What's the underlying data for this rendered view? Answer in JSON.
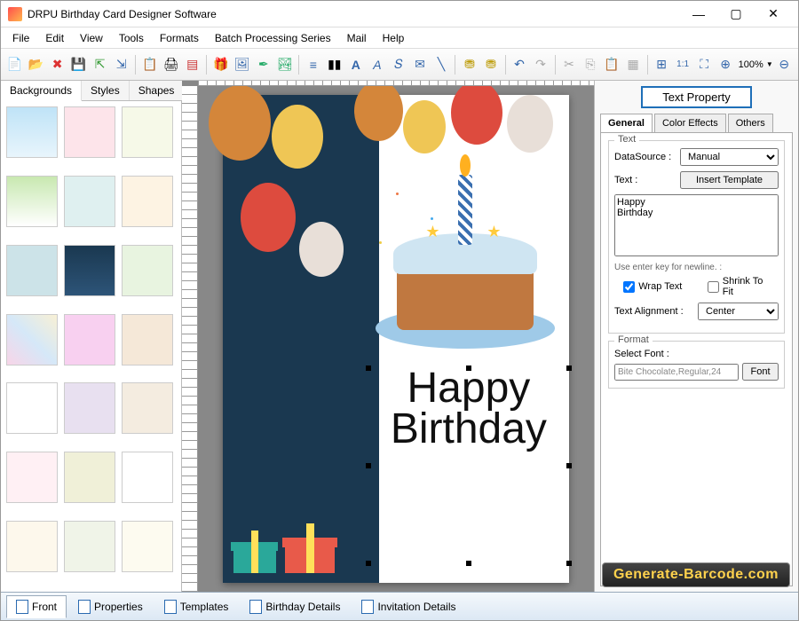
{
  "window": {
    "title": "DRPU Birthday Card Designer Software"
  },
  "menu": [
    "File",
    "Edit",
    "View",
    "Tools",
    "Formats",
    "Batch Processing Series",
    "Mail",
    "Help"
  ],
  "toolbar": {
    "zoom": "100%"
  },
  "leftPanel": {
    "tabs": [
      "Backgrounds",
      "Styles",
      "Shapes"
    ],
    "activeTab": 0
  },
  "rightPanel": {
    "title": "Text Property",
    "tabs": [
      "General",
      "Color Effects",
      "Others"
    ],
    "activeTab": 0,
    "textGroup": {
      "legend": "Text",
      "dataSourceLabel": "DataSource :",
      "dataSourceValue": "Manual",
      "textLabel": "Text :",
      "insertTemplate": "Insert Template",
      "textValue": "Happy\nBirthday",
      "hint": "Use enter key for newline. :",
      "wrapText": "Wrap Text",
      "shrinkToFit": "Shrink To Fit",
      "alignLabel": "Text Alignment :",
      "alignValue": "Center"
    },
    "formatGroup": {
      "legend": "Format",
      "selectFontLabel": "Select Font :",
      "fontDisplay": "Bite Chocolate,Regular,24",
      "fontBtn": "Font"
    }
  },
  "bottomTabs": [
    "Front",
    "Properties",
    "Templates",
    "Birthday Details",
    "Invitation Details"
  ],
  "card": {
    "textLine1": "Happy",
    "textLine2": "Birthday"
  },
  "watermark": "Generate-Barcode.com",
  "thumbs": [
    "linear-gradient(#bfe3f7,#e8f5fc)",
    "#fde4ea",
    "#f6f9e8",
    "linear-gradient(#c8e8b0,#fff)",
    "#dff0f0",
    "#fdf3e3",
    "#cce3e8",
    "linear-gradient(#1a3850,#2d5478)",
    "#e8f4e0",
    "linear-gradient(45deg,#f8d5e8,#d5e8f8,#f8f0d5)",
    "#f8d0f0",
    "#f5e8d8",
    "#fff",
    "#e8e0f0",
    "#f4ece0",
    "#fff0f4",
    "#f0f0d8",
    "#fff",
    "#fdf8ec",
    "#f0f4e8",
    "#fdfbf0"
  ]
}
